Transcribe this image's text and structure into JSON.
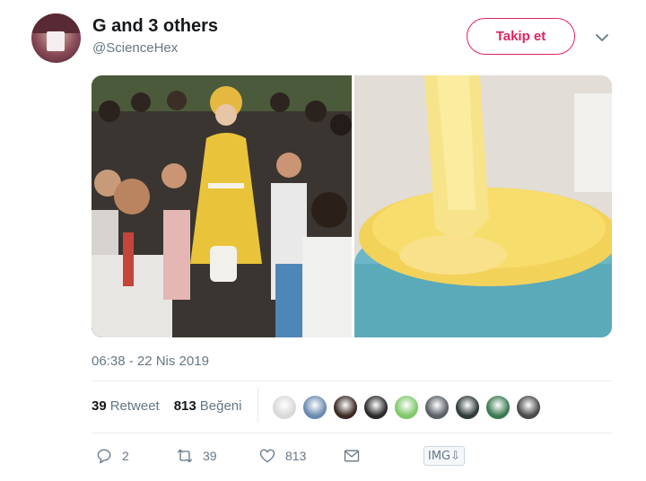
{
  "tweet": {
    "display_name": "G and 3 others",
    "handle": "@ScienceHex",
    "follow_label": "Takip et",
    "timestamp": "06:38 - 22 Nis 2019"
  },
  "stats": {
    "retweet_count": "39",
    "retweet_label": "Retweet",
    "like_count": "813",
    "like_label": "Beğeni"
  },
  "actions": {
    "reply_count": "2",
    "retweet_count": "39",
    "like_count": "813"
  },
  "toolbar": {
    "img_label": "IMG⇩"
  },
  "colors": {
    "accent": "#e0245e",
    "muted": "#657786",
    "text": "#14171a",
    "divider": "#e6ecf0"
  },
  "likers": [
    {
      "color": "#d9d9d9"
    },
    {
      "color": "#6a8ab0"
    },
    {
      "color": "#3a2a24"
    },
    {
      "color": "#2a2a2a"
    },
    {
      "color": "#7fc86a"
    },
    {
      "color": "#5a5f66"
    },
    {
      "color": "#2f3a3a"
    },
    {
      "color": "#3a7a52"
    },
    {
      "color": "#4a4a4a"
    }
  ]
}
